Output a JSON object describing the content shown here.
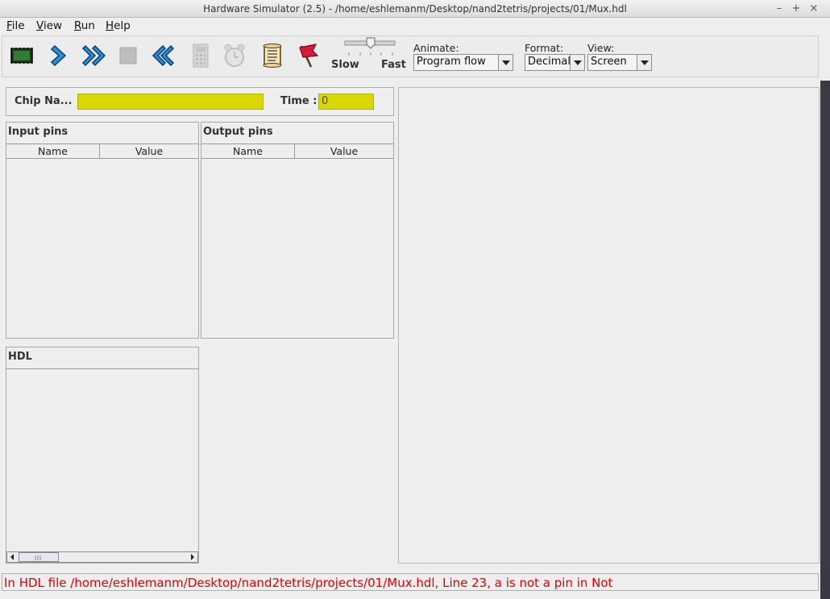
{
  "window": {
    "title": "Hardware Simulator (2.5) - /home/eshlemanm/Desktop/nand2tetris/projects/01/Mux.hdl",
    "controls": {
      "minimize": "–",
      "maximize": "+",
      "close": "×"
    }
  },
  "menubar": {
    "items": [
      {
        "first": "F",
        "rest": "ile"
      },
      {
        "first": "V",
        "rest": "iew"
      },
      {
        "first": "R",
        "rest": "un"
      },
      {
        "first": "H",
        "rest": "elp"
      }
    ]
  },
  "toolbar": {
    "buttons": [
      "chip-icon",
      "single-step-icon",
      "run-icon",
      "stop-icon",
      "reset-icon",
      "calculator-icon",
      "clock-icon",
      "script-icon",
      "breakpoint-flag-icon"
    ],
    "speed": {
      "slow_label": "Slow",
      "fast_label": "Fast",
      "level": 0.5
    },
    "animate": {
      "label": "Animate:",
      "value": "Program flow"
    },
    "format": {
      "label": "Format:",
      "value": "Decimal"
    },
    "view": {
      "label": "View:",
      "value": "Screen"
    }
  },
  "chip": {
    "name_label": "Chip Na...",
    "name_value": "",
    "time_label": "Time :",
    "time_value": "0",
    "field_color": "#d8d800"
  },
  "input_pins": {
    "title": "Input pins",
    "columns": [
      "Name",
      "Value"
    ],
    "rows": []
  },
  "output_pins": {
    "title": "Output pins",
    "columns": [
      "Name",
      "Value"
    ],
    "rows": []
  },
  "hdl": {
    "title": "HDL",
    "content": ""
  },
  "status": {
    "message": "In HDL file /home/eshlemanm/Desktop/nand2tetris/projects/01/Mux.hdl, Line 23, a is not a pin in Not",
    "color": "#e00000"
  }
}
